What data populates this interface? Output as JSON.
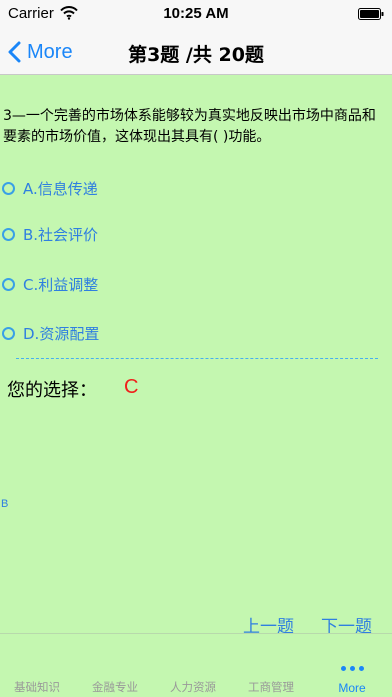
{
  "status_bar": {
    "carrier": "Carrier",
    "time": "10:25 AM"
  },
  "nav": {
    "back_label": "More",
    "title": "第3题 /共 20题"
  },
  "question": {
    "text": "3—一个完善的市场体系能够较为真实地反映出市场中商品和要素的市场价值，这体现出其具有( )功能。"
  },
  "options": [
    {
      "label": "A.信息传递"
    },
    {
      "label": "B.社会评价"
    },
    {
      "label": "C.利益调整"
    },
    {
      "label": "D.资源配置"
    }
  ],
  "answer": {
    "label": "您的选择：",
    "value": "C"
  },
  "stray_text": "B",
  "pager": {
    "prev_label": "上一题",
    "next_label": "下一题"
  },
  "tabs": [
    {
      "label": "基础知识"
    },
    {
      "label": "金融专业"
    },
    {
      "label": "人力资源"
    },
    {
      "label": "工商管理"
    },
    {
      "label": "More",
      "icon": "more-dots-icon"
    }
  ],
  "colors": {
    "background": "#c4f7b0",
    "accent": "#1a86f8",
    "answer": "#f0201b"
  }
}
